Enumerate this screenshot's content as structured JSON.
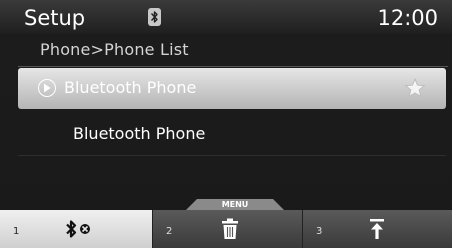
{
  "status_bar": {
    "title": "Setup",
    "clock": "12:00",
    "status_icon": "bluetooth-icon"
  },
  "breadcrumb": "Phone>Phone List",
  "list": {
    "items": [
      {
        "label": "Bluetooth Phone",
        "selected": true,
        "leading_icon": "play-circle-icon",
        "trailing_icon": "star-icon"
      },
      {
        "label": "Bluetooth Phone",
        "selected": false
      }
    ]
  },
  "menu_tab": {
    "label": "MENU"
  },
  "softkeys": [
    {
      "number": "1",
      "icon": "bluetooth-disconnect-icon"
    },
    {
      "number": "2",
      "icon": "trash-icon"
    },
    {
      "number": "3",
      "icon": "move-to-top-icon"
    }
  ],
  "colors": {
    "panel": "#1c1c1c",
    "selected_row": "#cfcfcf",
    "softkey_active": "#e6e6e6",
    "softkey_inactive": "#4a4a4a"
  }
}
